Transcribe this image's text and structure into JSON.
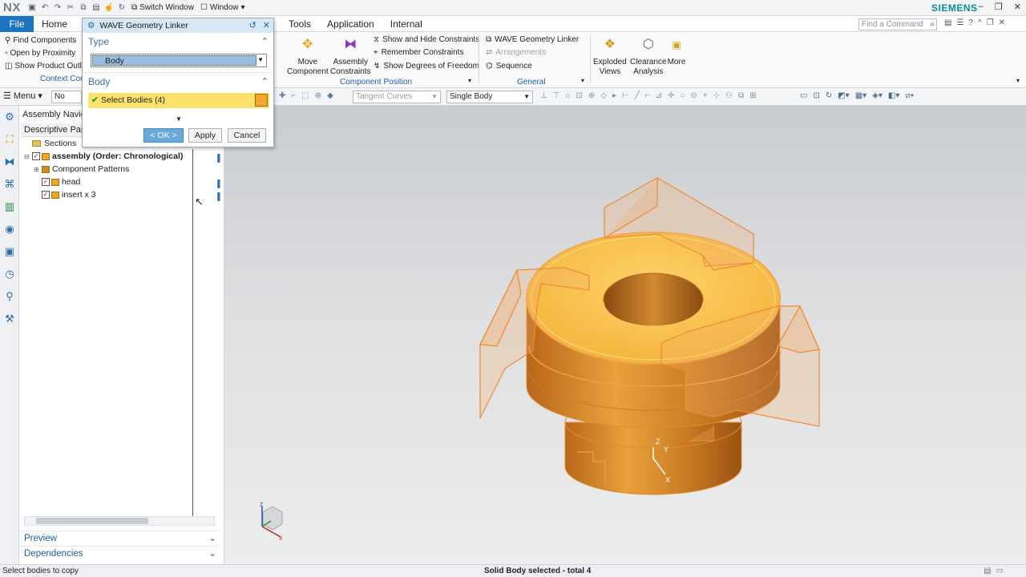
{
  "app": {
    "logo": "NX",
    "brand": "SIEMENS",
    "switch_window": "Switch Window",
    "window_menu": "Window"
  },
  "menubar": {
    "file": "File",
    "home": "Home",
    "tabs_right": [
      "Tools",
      "Application",
      "Internal"
    ],
    "find_placeholder": "Find a Command"
  },
  "ribbon": {
    "left_items": [
      "Find Components",
      "Open by Proximity",
      "Show Product Outli"
    ],
    "left_group": "Context Con",
    "move_component": [
      "Move",
      "Component"
    ],
    "assembly_constraints": [
      "Assembly",
      "Constraints"
    ],
    "constraint_items": [
      "Show and Hide Constraints",
      "Remember Constraints",
      "Show Degrees of Freedom"
    ],
    "component_position_label": "Component Position",
    "general_items": [
      "WAVE Geometry Linker",
      "Arrangements",
      "Sequence"
    ],
    "general_label": "General",
    "exploded_views": [
      "Exploded",
      "Views"
    ],
    "clearance_analysis": [
      "Clearance",
      "Analysis"
    ],
    "more": "More"
  },
  "toolbar": {
    "menu": "Menu",
    "no_selection": "No Selec",
    "curve_rule": "Tangent Curves",
    "body_rule": "Single Body"
  },
  "dialog": {
    "title": "WAVE Geometry Linker",
    "type_section": "Type",
    "type_value": "Body",
    "body_section": "Body",
    "select_bodies": "Select Bodies (4)",
    "ok": "< OK >",
    "apply": "Apply",
    "cancel": "Cancel"
  },
  "navigator": {
    "title": "Assembly Navig",
    "column_header": "Descriptive Part",
    "tree": [
      {
        "label": "Sections",
        "indent": 1,
        "checkbox": false,
        "kind": "folder"
      },
      {
        "label": "assembly (Order: Chronological)",
        "indent": 1,
        "checkbox": true,
        "kind": "assembly"
      },
      {
        "label": "Component Patterns",
        "indent": 2,
        "checkbox": false,
        "kind": "pattern"
      },
      {
        "label": "head",
        "indent": 2,
        "checkbox": true,
        "kind": "part"
      },
      {
        "label": "insert x 3",
        "indent": 2,
        "checkbox": true,
        "kind": "part"
      }
    ],
    "preview": "Preview",
    "dependencies": "Dependencies"
  },
  "triad": {
    "x": "X",
    "y": "Y",
    "z": "Z"
  },
  "status": {
    "left": "Select bodies to copy",
    "middle": "Solid Body selected - total 4"
  },
  "colors": {
    "accent": "#1e73be",
    "brand": "#0a8a9a",
    "part_orange": "#f2b23a",
    "select_yellow": "#fbe26a"
  }
}
